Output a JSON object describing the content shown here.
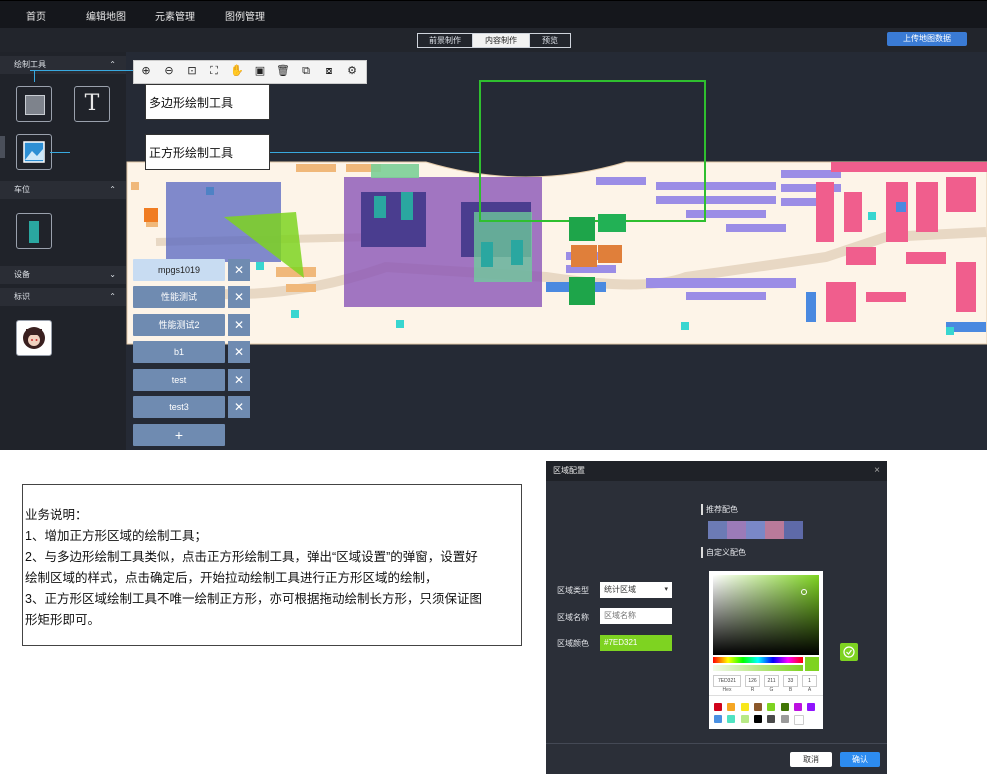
{
  "nav": {
    "items": [
      "首页",
      "编辑地图",
      "元素管理",
      "图例管理"
    ]
  },
  "subbar": {
    "segments": [
      "前景制作",
      "内容制作",
      "预览"
    ],
    "active_index": 1,
    "upload_label": "上传地图数据"
  },
  "left": {
    "sections": [
      {
        "title": "绘制工具",
        "chev": "⌃"
      },
      {
        "title": "车位",
        "chev": "⌃"
      },
      {
        "title": "设备",
        "chev": "⌄"
      },
      {
        "title": "标识",
        "chev": "⌃"
      }
    ],
    "text_tool_glyph": "T"
  },
  "callouts": {
    "polygon": "多边形绘制工具",
    "rect": "正方形绘制工具"
  },
  "layers": [
    {
      "label": "mpgs1019",
      "selected": true
    },
    {
      "label": "性能测试",
      "selected": false
    },
    {
      "label": "性能测试2",
      "selected": false
    },
    {
      "label": "b1",
      "selected": false
    },
    {
      "label": "test",
      "selected": false
    },
    {
      "label": "test3",
      "selected": false
    }
  ],
  "add_layer_glyph": "+",
  "close_glyph": "✕",
  "description": {
    "title": "业务说明：",
    "lines": [
      "1、增加正方形区域的绘制工具；",
      "2、与多边形绘制工具类似，点击正方形绘制工具，弹出“区域设置”的弹窗，设置好",
      "绘制区域的样式，点击确定后，开始拉动绘制工具进行正方形区域的绘制，",
      "3、正方形区域绘制工具不唯一绘制正方形，亦可根据拖动绘制长方形，只须保证图",
      "形矩形即可。"
    ]
  },
  "dialog": {
    "title": "区域配置",
    "close": "×",
    "recommended_label": "推荐配色",
    "custom_label": "自定义配色",
    "recommended_colors": [
      "#6c7bb5",
      "#9b7bb8",
      "#7a88c7",
      "#b97a9a",
      "#5e6aa8"
    ],
    "type_label": "区域类型",
    "type_value": "统计区域",
    "name_label": "区域名称",
    "name_placeholder": "区域名称",
    "color_label": "区域颜色",
    "color_value": "#7ED321",
    "picker": {
      "hex": "7ED321",
      "r": "126",
      "g": "211",
      "b": "33",
      "a": "1",
      "hex_label": "Hex",
      "r_label": "R",
      "g_label": "G",
      "b_label": "B",
      "a_label": "A",
      "presets_row1": [
        "#d0021b",
        "#f5a623",
        "#f8e71c",
        "#8b572a",
        "#7ed321",
        "#417505",
        "#bd10e0",
        "#9013fe"
      ],
      "presets_row2": [
        "#4a90e2",
        "#50e3c2",
        "#b8e986",
        "#000000",
        "#4a4a4a",
        "#9b9b9b",
        "#ffffff"
      ]
    },
    "cancel_label": "取消",
    "ok_label": "确认"
  }
}
